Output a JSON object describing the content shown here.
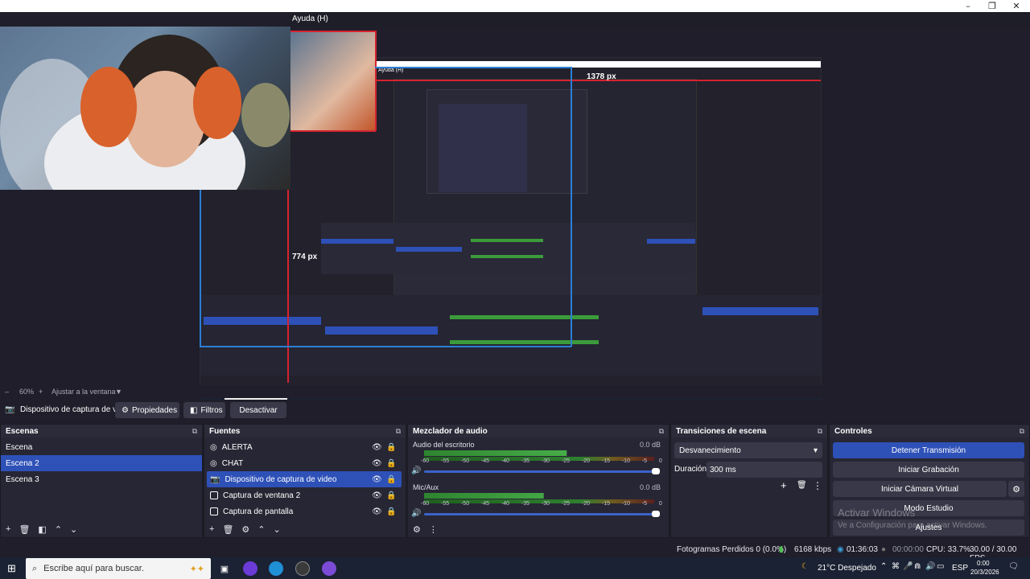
{
  "window": {
    "minimize": "–",
    "restore": "❐",
    "close": "✕",
    "menu_help": "Ayuda (H)"
  },
  "preview": {
    "measure_width": "1378 px",
    "measure_height": "774 px",
    "nested_menu_help": "Ayuda (H)",
    "nested_measure_width": "1378 px",
    "nested_measure_height": "774 px"
  },
  "zoom": {
    "minus": "–",
    "value": "60%",
    "plus": "+",
    "fit": "Ajustar a la ventana",
    "dropdown": "▼"
  },
  "source_toolbar": {
    "source_name": "Dispositivo de captura de v",
    "properties": "Propiedades",
    "filters": "Filtros",
    "deactivate": "Desactivar"
  },
  "scenes": {
    "title": "Escenas",
    "items": [
      "Escena",
      "Escena 2",
      "Escena 3"
    ],
    "selected": 1
  },
  "sources": {
    "title": "Fuentes",
    "items": [
      "ALERTA",
      "CHAT",
      "Dispositivo de captura de video",
      "Captura de ventana 2",
      "Captura de pantalla"
    ],
    "selected": 2
  },
  "mixer": {
    "title": "Mezclador de audio",
    "channels": [
      {
        "name": "Audio del escritorio",
        "db": "0.0 dB",
        "level": 0.62,
        "volume": 1.0
      },
      {
        "name": "Mic/Aux",
        "db": "0.0 dB",
        "level": 0.52,
        "volume": 1.0
      }
    ],
    "scale": [
      "-60",
      "-55",
      "-50",
      "-45",
      "-40",
      "-35",
      "-30",
      "-25",
      "-20",
      "-15",
      "-10",
      "-5",
      "0"
    ]
  },
  "transitions": {
    "title": "Transiciones de escena",
    "type": "Desvanecimiento",
    "duration_label": "Duración",
    "duration_value": "300 ms"
  },
  "controls": {
    "title": "Controles",
    "stop_stream": "Detener Transmisión",
    "start_recording": "Iniciar Grabación",
    "start_virtual_cam": "Iniciar Cámara Virtual",
    "studio_mode": "Modo Estudio",
    "settings": "Ajustes"
  },
  "watermark": {
    "line1": "Activar Windows",
    "line2": "Ve a Configuración para activar Windows."
  },
  "status": {
    "dropped": "Fotogramas Perdidos 0 (0.0%)",
    "bitrate": "6168 kbps",
    "stream_time": "01:36:03",
    "rec_time": "00:00:00",
    "cpu": "CPU: 33.7%",
    "fps": "30.00 / 30.00 FPS"
  },
  "taskbar": {
    "search_placeholder": "Escribe aquí para buscar.",
    "weather": "21°C  Despejado",
    "lang": "ESP",
    "time": "0:00",
    "date": "20/3/2026"
  },
  "colors": {
    "accent": "#2e51b8",
    "bg": "#1f1e2a",
    "dock": "#272634",
    "red": "#d5232f",
    "blue": "#2b7fd6"
  }
}
